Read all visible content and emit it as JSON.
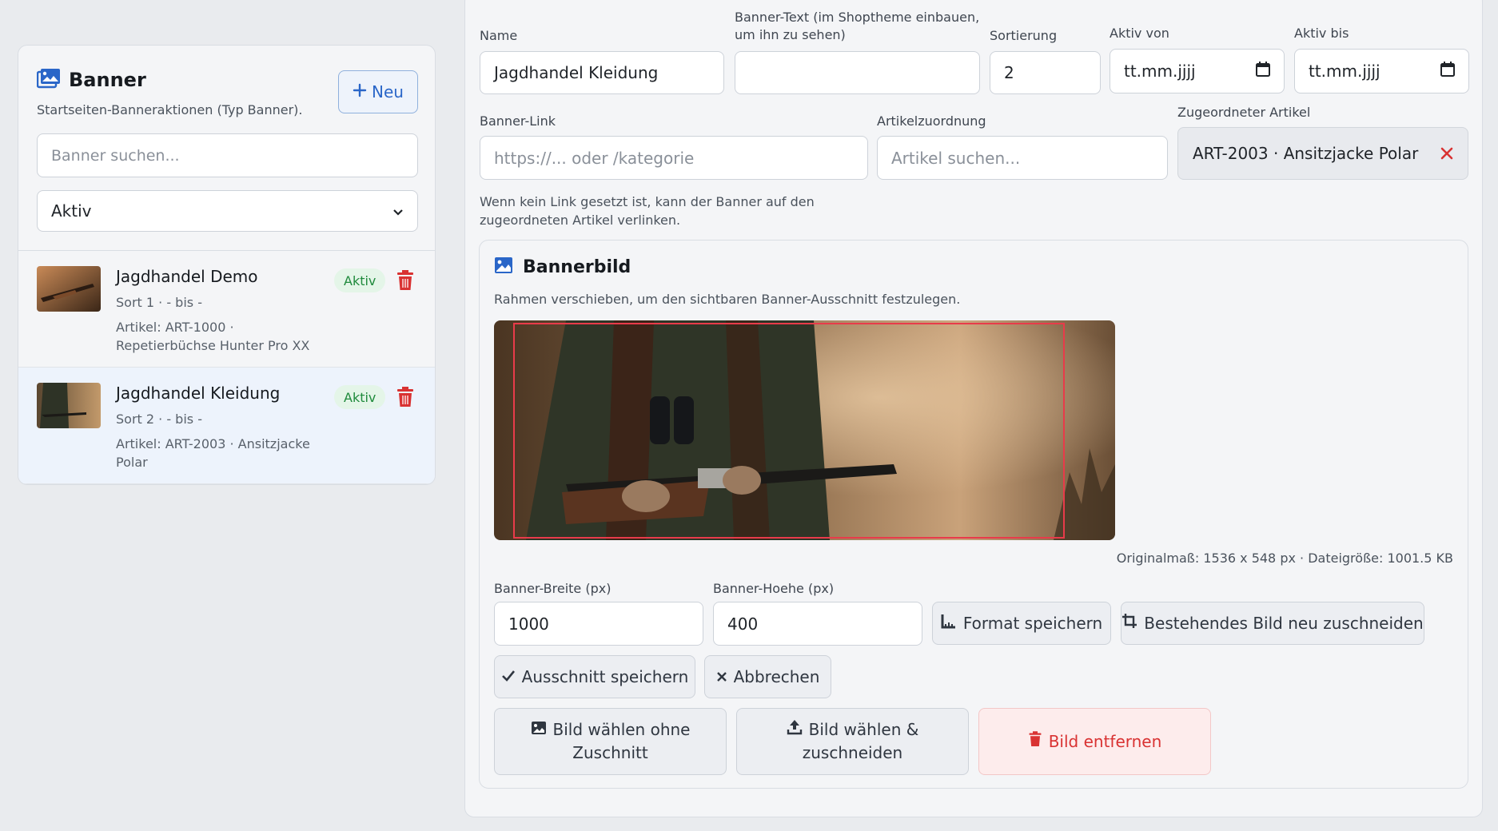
{
  "sidebar": {
    "title": "Banner",
    "subtitle": "Startseiten-Banneraktionen (Typ Banner).",
    "new_button": "Neu",
    "search_placeholder": "Banner suchen...",
    "filter_value": "Aktiv",
    "items": [
      {
        "title": "Jagdhandel Demo",
        "meta": "Sort 1 · - bis -",
        "article": "Artikel: ART-1000 · Repetierbüchse Hunter Pro XX",
        "badge": "Aktiv"
      },
      {
        "title": "Jagdhandel Kleidung",
        "meta": "Sort 2 · - bis -",
        "article": "Artikel: ART-2003 · Ansitzjacke Polar",
        "badge": "Aktiv"
      }
    ]
  },
  "form": {
    "name_label": "Name",
    "name_value": "Jagdhandel Kleidung",
    "banner_text_label": "Banner-Text (im Shoptheme einbauen, um ihn zu sehen)",
    "banner_text_value": "",
    "sort_label": "Sortierung",
    "sort_value": "2",
    "active_from_label": "Aktiv von",
    "active_from_value": "tt.mm.jjjj",
    "active_to_label": "Aktiv bis",
    "active_to_value": "tt.mm.jjjj",
    "link_label": "Banner-Link",
    "link_placeholder": "https://... oder /kategorie",
    "article_assign_label": "Artikelzuordnung",
    "article_assign_placeholder": "Artikel suchen...",
    "assigned_label": "Zugeordneter Artikel",
    "assigned_value": "ART-2003 · Ansitzjacke Polar",
    "hint": "Wenn kein Link gesetzt ist, kann der Banner auf den zugeordneten Artikel verlinken."
  },
  "image": {
    "title": "Bannerbild",
    "subtitle": "Rahmen verschieben, um den sichtbaren Banner-Ausschnitt festzulegen.",
    "info": "Originalmaß: 1536 x 548 px · Dateigröße: 1001.5 KB",
    "width_label": "Banner-Breite (px)",
    "width_value": "1000",
    "height_label": "Banner-Hoehe (px)",
    "height_value": "400",
    "format_save": "Format speichern",
    "recrop": "Bestehendes Bild neu zuschneiden",
    "crop_save": "Ausschnitt speichern",
    "cancel": "Abbrechen",
    "choose_no_crop_1": "Bild wählen ohne",
    "choose_no_crop_2": "Zuschnitt",
    "choose_crop_1": "Bild wählen &",
    "choose_crop_2": "zuschneiden",
    "remove": "Bild entfernen"
  },
  "colors": {
    "accent": "#2a66c8",
    "danger": "#d93232",
    "success": "#1f8a3c",
    "crop_frame": "#e83b4a"
  },
  "icons": [
    "images-icon",
    "plus-icon",
    "chevron-down-icon",
    "trash-icon",
    "calendar-icon",
    "close-icon",
    "image-icon",
    "ruler-icon",
    "crop-icon",
    "check-icon",
    "upload-icon"
  ]
}
